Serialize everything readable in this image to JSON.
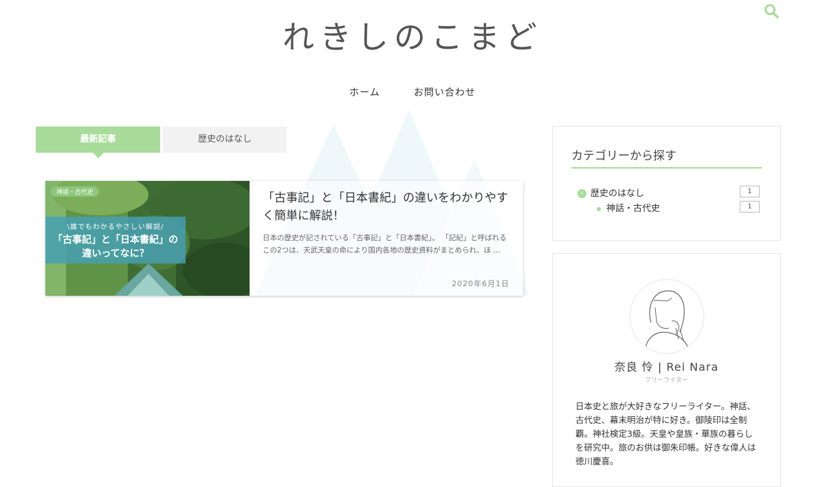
{
  "site": {
    "title": "れきしのこまど"
  },
  "header": {
    "search_icon": "search-icon"
  },
  "nav": {
    "items": [
      {
        "label": "ホーム"
      },
      {
        "label": "お問い合わせ"
      }
    ]
  },
  "tabs": [
    {
      "label": "最新記事",
      "active": true
    },
    {
      "label": "歴史のはなし",
      "active": false
    }
  ],
  "articles": [
    {
      "category": "神話・古代史",
      "thumb_sub": "\\誰でもわかるやさしい解説/",
      "thumb_main": "「古事記」と「日本書紀」の違いってなに？",
      "title": "「古事記」と「日本書紀」の違いをわかりやすく簡単に解説！",
      "excerpt": "日本の歴史が記されている「古事記」と「日本書紀」。 「記紀」と呼ばれるこの2つは、天武天皇の命により国内各地の歴史資料がまとめられ、ほ …",
      "date": "2020年6月1日"
    }
  ],
  "sidebar": {
    "categories": {
      "title": "カテゴリーから探す",
      "items": [
        {
          "label": "歴史のはなし",
          "count": "1",
          "icon": "chevron-right-icon"
        },
        {
          "label": "神話・古代史",
          "count": "1",
          "icon": "dot-icon"
        }
      ]
    },
    "profile": {
      "name": "奈良 怜 | Rei Nara",
      "role": "フリーライター",
      "bio": "日本史と旅が大好きなフリーライター。神話、古代史、幕末明治が特に好き。御陵印は全制覇。神社検定3級。天皇や皇族・華族の暮らしを研究中。旅のお供は御朱印帳。好きな偉人は徳川慶喜。"
    }
  },
  "colors": {
    "accent": "#a9dc9b",
    "accent_dark": "#8dc77b",
    "deco": "#eef7fa"
  }
}
